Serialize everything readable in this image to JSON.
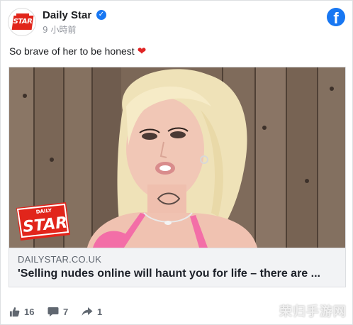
{
  "post": {
    "page_name": "Daily Star",
    "verified": true,
    "timestamp": "9 小時前",
    "avatar_label": "STAR",
    "text": "So brave of her to be honest",
    "emoji": "❤"
  },
  "link": {
    "domain": "DAILYSTAR.CO.UK",
    "title": "'Selling nudes online will haunt you for life – there are ...",
    "image_badge_top": "DAILY",
    "image_badge_main": "STAR"
  },
  "actions": {
    "likes": "16",
    "comments": "7",
    "shares": "1"
  },
  "watermark": "荣归手游网",
  "colors": {
    "brand_red": "#e1251b",
    "facebook_blue": "#1877f2",
    "meta_gray": "#606770"
  }
}
